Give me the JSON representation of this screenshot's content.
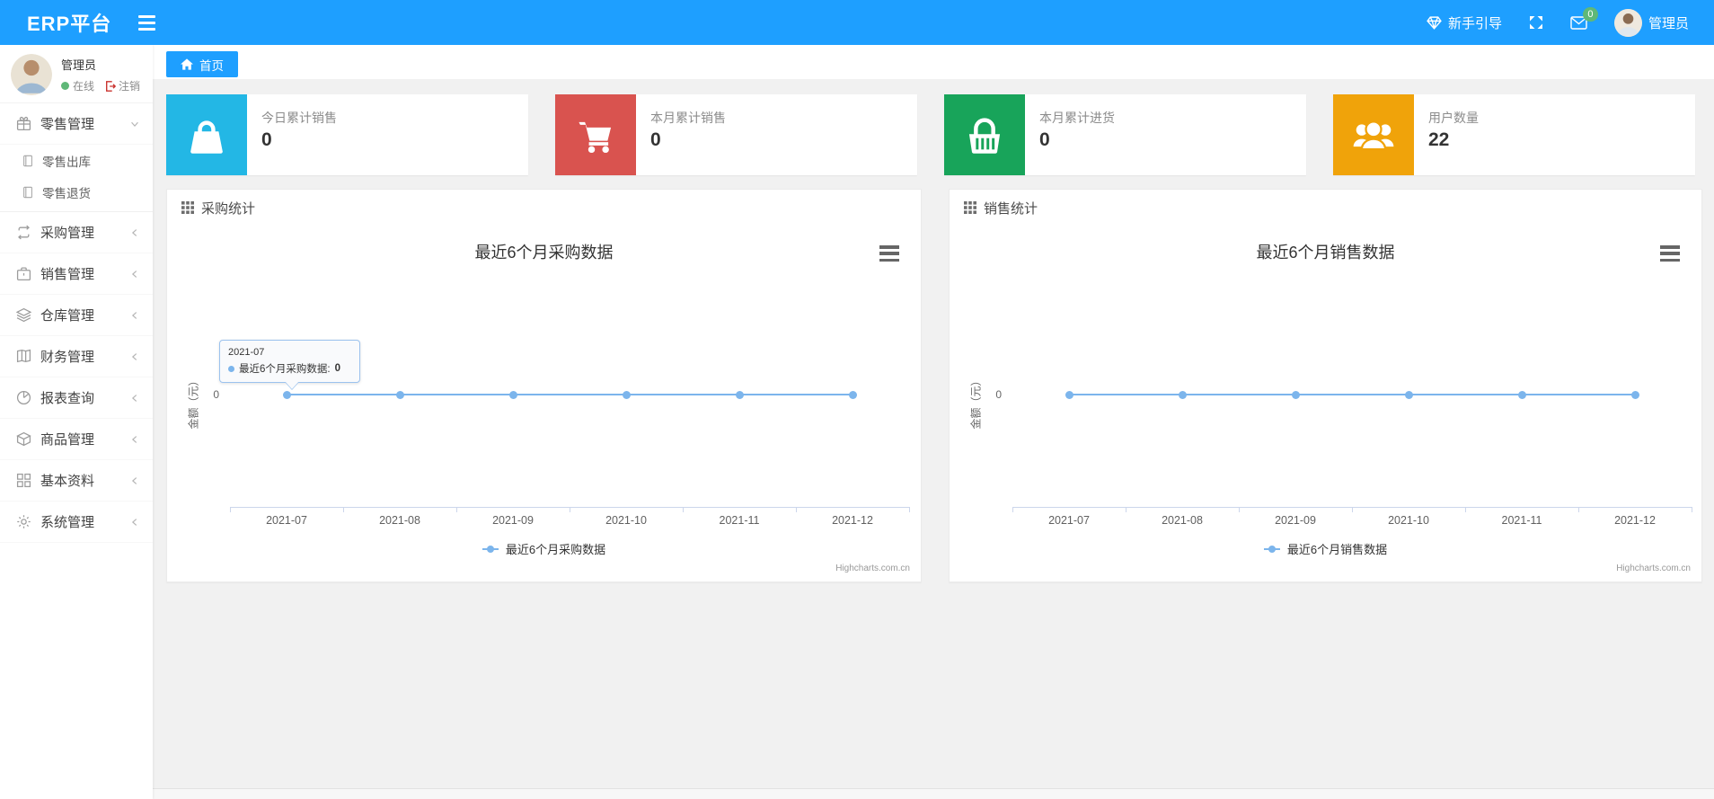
{
  "colors": {
    "navbar": "#1E9FFF",
    "badge_green": "#5FB878",
    "series_blue": "#7cb5ec",
    "card_cyan": "#23b7e5",
    "card_red": "#d9534f",
    "card_green": "#18a45a",
    "card_orange": "#f0a30a"
  },
  "navbar": {
    "brand": "ERP平台",
    "guide_label": "新手引导",
    "message_badge": "0",
    "username": "管理员"
  },
  "sidebar": {
    "user": {
      "name": "管理员",
      "status_label": "在线",
      "logout_label": "注销"
    },
    "menu": [
      {
        "label": "零售管理",
        "icon": "gift-icon",
        "state": "expanded",
        "children": [
          {
            "label": "零售出库",
            "icon": "doc-icon"
          },
          {
            "label": "零售退货",
            "icon": "doc-icon"
          }
        ]
      },
      {
        "label": "采购管理",
        "icon": "repeat-icon",
        "state": "collapsed"
      },
      {
        "label": "销售管理",
        "icon": "briefcase-icon",
        "state": "collapsed"
      },
      {
        "label": "仓库管理",
        "icon": "layers-icon",
        "state": "collapsed"
      },
      {
        "label": "财务管理",
        "icon": "book-icon",
        "state": "collapsed"
      },
      {
        "label": "报表查询",
        "icon": "pie-icon",
        "state": "collapsed"
      },
      {
        "label": "商品管理",
        "icon": "cube-icon",
        "state": "collapsed"
      },
      {
        "label": "基本资料",
        "icon": "grid-icon",
        "state": "collapsed"
      },
      {
        "label": "系统管理",
        "icon": "gear-icon",
        "state": "collapsed"
      }
    ]
  },
  "tabs": {
    "home_label": "首页"
  },
  "stat_cards": [
    {
      "label": "今日累计销售",
      "value": "0",
      "icon": "shopping-bag-icon",
      "color": "#23b7e5"
    },
    {
      "label": "本月累计销售",
      "value": "0",
      "icon": "shopping-cart-icon",
      "color": "#d9534f"
    },
    {
      "label": "本月累计进货",
      "value": "0",
      "icon": "shopping-basket-icon",
      "color": "#18a45a"
    },
    {
      "label": "用户数量",
      "value": "22",
      "icon": "users-icon",
      "color": "#f0a30a"
    }
  ],
  "chart_data": [
    {
      "type": "line",
      "panel_title": "采购统计",
      "title": "最近6个月采购数据",
      "categories": [
        "2021-07",
        "2021-08",
        "2021-09",
        "2021-10",
        "2021-11",
        "2021-12"
      ],
      "series": [
        {
          "name": "最近6个月采购数据",
          "values": [
            0,
            0,
            0,
            0,
            0,
            0
          ],
          "color": "#7cb5ec"
        }
      ],
      "ylabel": "金额（元）",
      "yticks": [
        "0"
      ],
      "grid": false,
      "legend_position": "bottom",
      "credits": "Highcharts.com.cn",
      "tooltip": {
        "visible": true,
        "category": "2021-07",
        "series_label": "最近6个月采购数据:",
        "value": "0"
      }
    },
    {
      "type": "line",
      "panel_title": "销售统计",
      "title": "最近6个月销售数据",
      "categories": [
        "2021-07",
        "2021-08",
        "2021-09",
        "2021-10",
        "2021-11",
        "2021-12"
      ],
      "series": [
        {
          "name": "最近6个月销售数据",
          "values": [
            0,
            0,
            0,
            0,
            0,
            0
          ],
          "color": "#7cb5ec"
        }
      ],
      "ylabel": "金额（元）",
      "yticks": [
        "0"
      ],
      "grid": false,
      "legend_position": "bottom",
      "credits": "Highcharts.com.cn",
      "tooltip": {
        "visible": false
      }
    }
  ]
}
